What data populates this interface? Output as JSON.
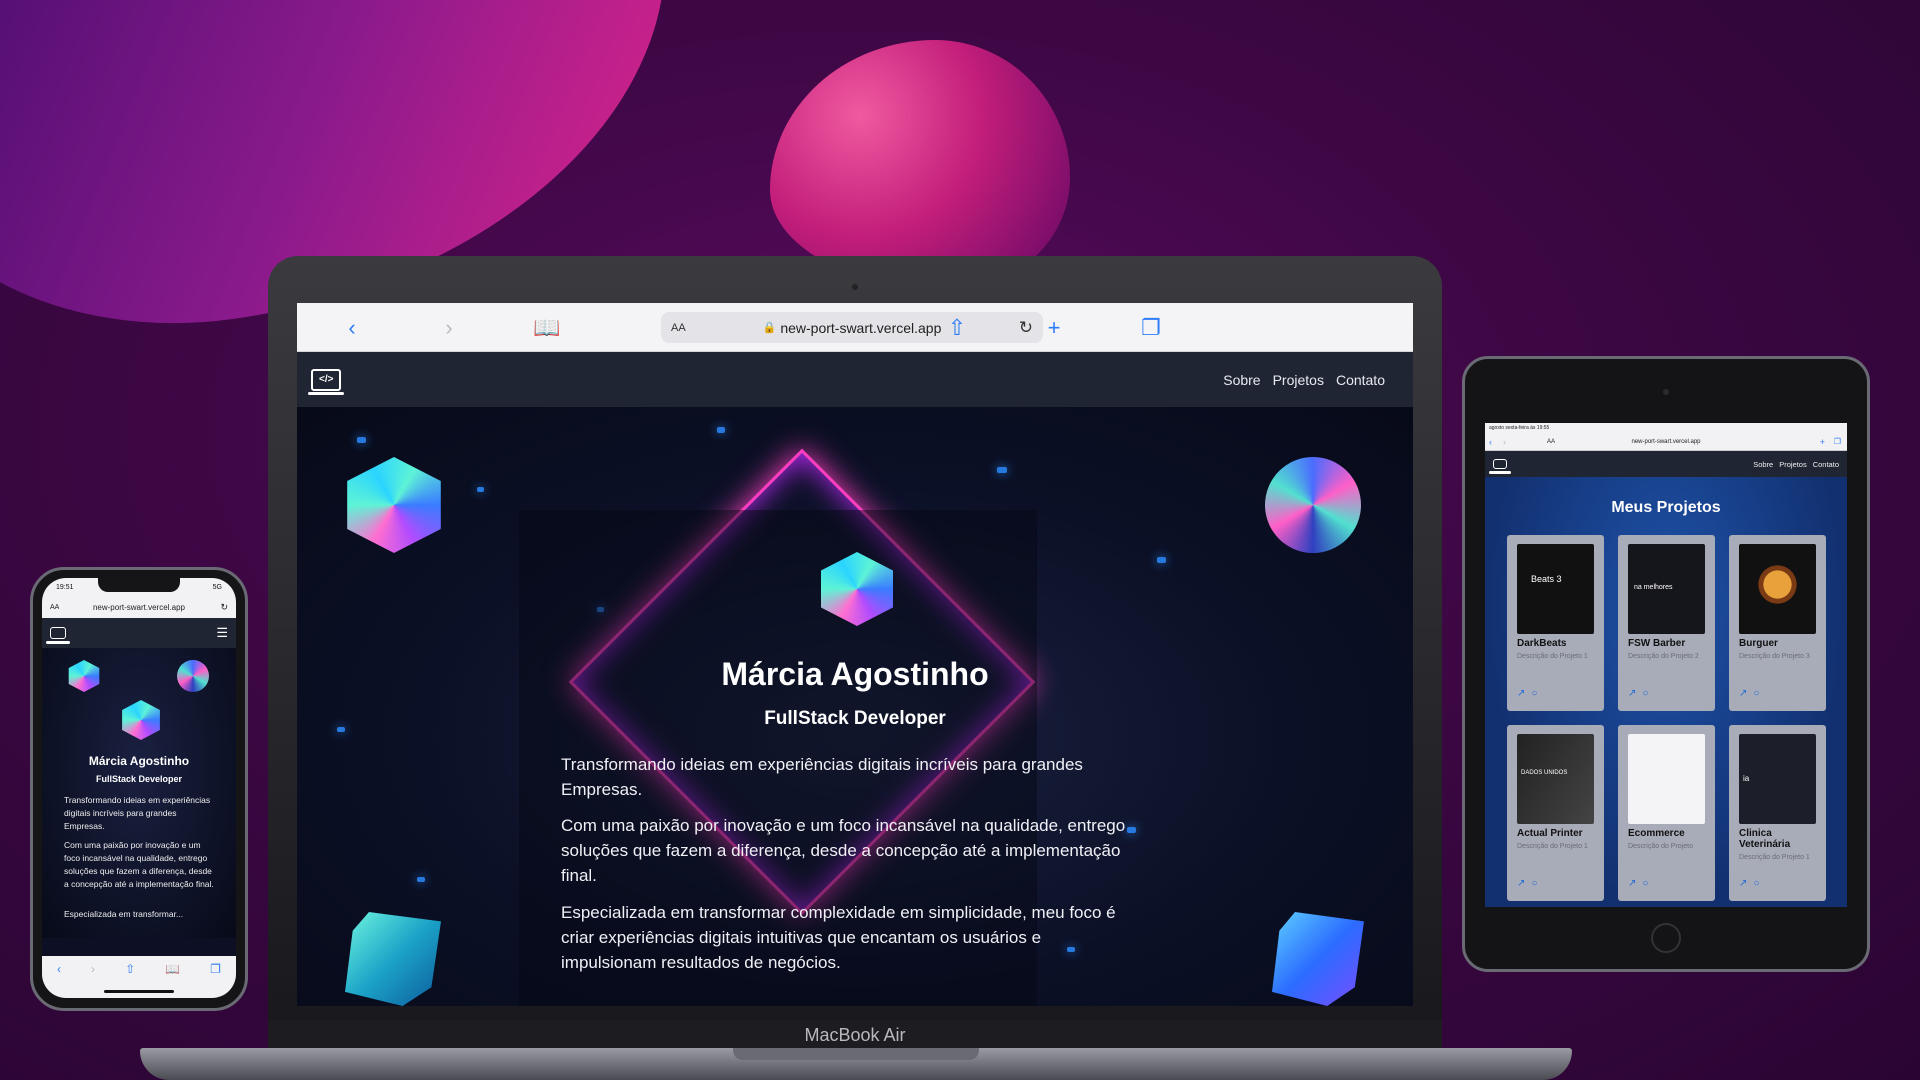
{
  "laptop": {
    "model_label": "MacBook Air",
    "browser": {
      "url": "new-port-swart.vercel.app",
      "text_size": "AA",
      "back_icon": "chevron-left-icon",
      "forward_icon": "chevron-right-icon",
      "bookmarks_icon": "book-icon",
      "share_icon": "share-icon",
      "new_tab_icon": "plus-icon",
      "tabs_icon": "tabs-icon",
      "accent_color": "#2f7cf6"
    },
    "site": {
      "nav": [
        "Sobre",
        "Projetos",
        "Contato"
      ],
      "name": "Márcia Agostinho",
      "role": "FullStack Developer",
      "paragraphs": [
        "Transformando ideias em experiências digitais incríveis para grandes Empresas.",
        "Com uma paixão por inovação e um foco incansável na qualidade, entrego soluções que fazem a diferença, desde a concepção até a implementação final.",
        "Especializada em transformar complexidade em simplicidade, meu foco é criar experiências digitais intuitivas que encantam os usuários e impulsionam resultados de negócios."
      ],
      "accent_color": "#ff3fbf"
    }
  },
  "phone": {
    "time": "19:51",
    "signal": "5G",
    "url": "new-port-swart.vercel.app",
    "text_size": "AA",
    "name": "Márcia Agostinho",
    "role": "FullStack Developer",
    "paragraphs": [
      "Transformando ideias em experiências digitais incríveis para grandes Empresas.",
      "Com uma paixão por inovação e um foco incansável na qualidade, entrego soluções que fazem a diferença, desde a concepção até a implementação final.",
      "Especializada em transformar..."
    ]
  },
  "tablet": {
    "status": "agosto sexta-feira às 19:55",
    "url": "new-port-swart.vercel.app",
    "text_size": "AA",
    "nav": [
      "Sobre",
      "Projetos",
      "Contato"
    ],
    "section_title": "Meus Projetos",
    "projects": [
      {
        "name": "DarkBeats",
        "desc": "Descrição do Projeto 1",
        "thumb_text": "Beats 3"
      },
      {
        "name": "FSW Barber",
        "desc": "Descrição do Projeto 2",
        "thumb_text": "na melhores"
      },
      {
        "name": "Burguer",
        "desc": "Descrição do Projeto 3",
        "thumb_text": ""
      },
      {
        "name": "Actual Printer",
        "desc": "Descrição do Projeto 1",
        "thumb_text": "DADOS UNIDOS"
      },
      {
        "name": "Ecommerce",
        "desc": "Descrição do Projeto",
        "thumb_text": ""
      },
      {
        "name": "Clinica Veterinária",
        "desc": "Descrição do Projeto 1",
        "thumb_text": "ia"
      }
    ]
  }
}
